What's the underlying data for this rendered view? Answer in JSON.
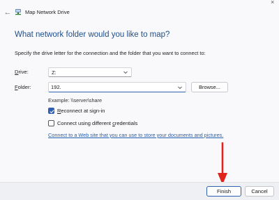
{
  "window": {
    "title": "Map Network Drive",
    "back_glyph": "←",
    "corner_glyph": "×"
  },
  "main": {
    "heading": "What network folder would you like to map?",
    "instruction": "Specify the drive letter for the connection and the folder that you want to connect to:"
  },
  "drive": {
    "label_prefix": "",
    "label_accel": "D",
    "label_rest": "rive:",
    "value": "Z:"
  },
  "folder": {
    "label_prefix": "",
    "label_accel": "F",
    "label_rest": "older:",
    "value": "192.",
    "browse_label": "Browse..."
  },
  "example_text": "Example: \\\\server\\share",
  "reconnect": {
    "label_accel": "R",
    "label_rest": "econnect at sign-in",
    "checked": true
  },
  "credentials": {
    "label_prefix": "Connect using different ",
    "label_accel": "c",
    "label_rest": "redentials",
    "checked": false
  },
  "link_text": "Connect to a Web site that you can use to store your documents and pictures.",
  "footer": {
    "finish_label": "Finish",
    "cancel_label": "Cancel"
  },
  "colors": {
    "accent": "#2f5fb0",
    "heading": "#1f4e8a",
    "annotation_arrow": "#e0241b"
  },
  "icons": {
    "back": "arrow-left-icon",
    "app": "network-drive-icon",
    "chevron": "chevron-down-icon",
    "check": "checkmark-icon",
    "annotation": "red-arrow-down-icon"
  }
}
